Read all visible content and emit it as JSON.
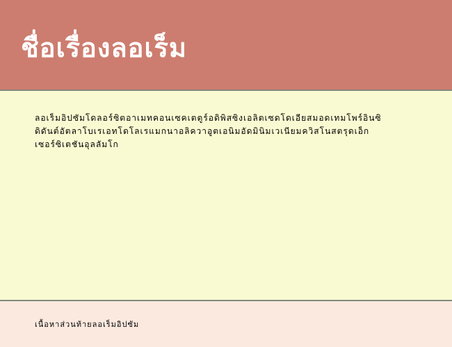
{
  "header": {
    "title": "ชื่อเรื่องลอเร็ม"
  },
  "content": {
    "paragraph": "ลอเร็มอิปซัมโดลอร์ซิตอาเมทคอนเซคเตตูร์อดิพิสซิงเอลิตเซดโดเอียสมอดเทมโพร์อินซิดิดันต์อัตลาโบเรเอทโดโลเรแมกนาอลิควาอูตเอนิมอัดมินิมเวเนียมควิสโนสตรุดเอ็กเซอร์ซิเตชันอุลลัมโก"
  },
  "footer": {
    "text": "เนื้อหาส่วนท้ายลอเร็มอิปซัม"
  }
}
